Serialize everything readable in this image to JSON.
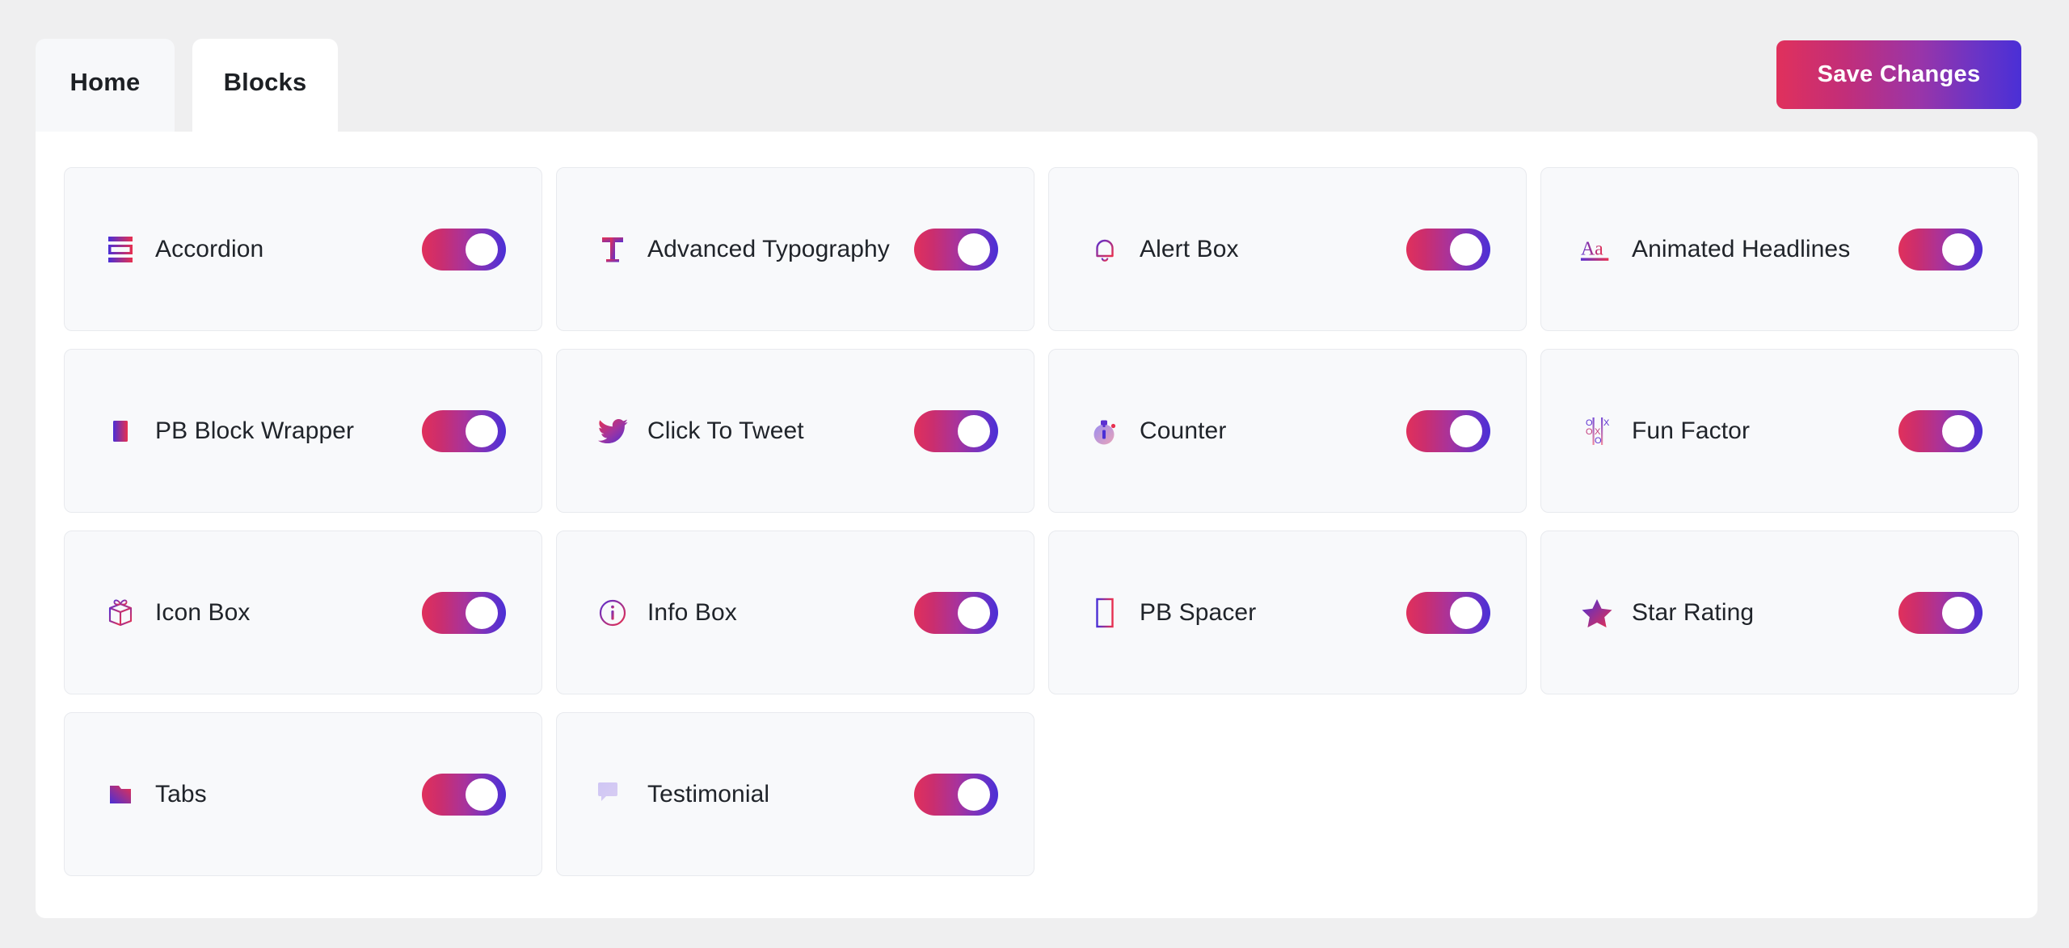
{
  "theme": {
    "page_background": "#efeff0",
    "panel_background": "#ffffff",
    "card_background": "#f8f9fb",
    "card_border": "#e8eaee",
    "gradient_start": "#e0305c",
    "gradient_end": "#4a2fd6",
    "text_color": "#20242a"
  },
  "tabs": [
    {
      "label": "Home",
      "active": false
    },
    {
      "label": "Blocks",
      "active": true
    }
  ],
  "toolbar": {
    "save_label": "Save Changes"
  },
  "blocks": [
    {
      "label": "Accordion",
      "icon": "accordion-icon",
      "enabled": true,
      "toggle_state": "on"
    },
    {
      "label": "Advanced Typography",
      "icon": "typography-t-icon",
      "enabled": true,
      "toggle_state": "on"
    },
    {
      "label": "Alert Box",
      "icon": "bell-icon",
      "enabled": true,
      "toggle_state": "on"
    },
    {
      "label": "Animated Headlines",
      "icon": "animated-headlines-aa-icon",
      "enabled": true,
      "toggle_state": "on"
    },
    {
      "label": "PB Block Wrapper",
      "icon": "block-wrapper-icon",
      "enabled": true,
      "toggle_state": "on"
    },
    {
      "label": "Click To Tweet",
      "icon": "twitter-bird-icon",
      "enabled": true,
      "toggle_state": "on"
    },
    {
      "label": "Counter",
      "icon": "stopwatch-icon",
      "enabled": true,
      "toggle_state": "on"
    },
    {
      "label": "Fun Factor",
      "icon": "tic-tac-toe-icon",
      "enabled": true,
      "toggle_state": "on"
    },
    {
      "label": "Icon Box",
      "icon": "gift-box-icon",
      "enabled": true,
      "toggle_state": "on"
    },
    {
      "label": "Info Box",
      "icon": "info-circle-icon",
      "enabled": true,
      "toggle_state": "on"
    },
    {
      "label": "PB Spacer",
      "icon": "spacer-rectangle-icon",
      "enabled": true,
      "toggle_state": "on"
    },
    {
      "label": "Star Rating",
      "icon": "star-icon",
      "enabled": true,
      "toggle_state": "on"
    },
    {
      "label": "Tabs",
      "icon": "folder-tabs-icon",
      "enabled": true,
      "toggle_state": "on"
    },
    {
      "label": "Testimonial",
      "icon": "speech-bubbles-icon",
      "enabled": true,
      "toggle_state": "on"
    }
  ]
}
